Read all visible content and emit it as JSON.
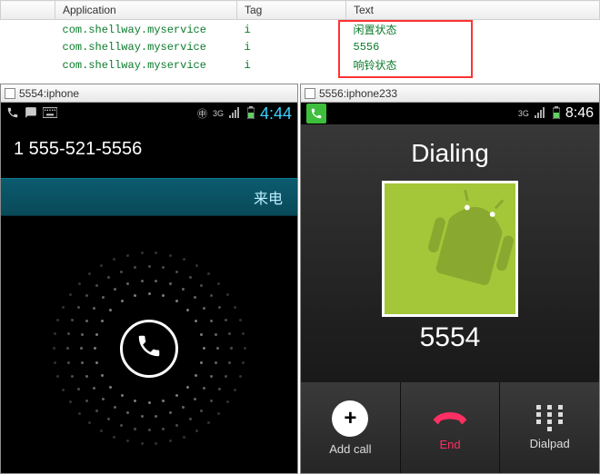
{
  "log": {
    "headers": {
      "blank": "",
      "application": "Application",
      "tag": "Tag",
      "text": "Text"
    },
    "rows": [
      {
        "app": "com.shellway.myservice",
        "tag": "i",
        "text": "闲置状态"
      },
      {
        "app": "com.shellway.myservice",
        "tag": "i",
        "text": "5556"
      },
      {
        "app": "com.shellway.myservice",
        "tag": "i",
        "text": "响铃状态"
      }
    ]
  },
  "emu1": {
    "title": "5554:iphone",
    "status": {
      "time": "4:44",
      "net": "3G"
    },
    "caller": "1 555-521-5556",
    "incoming_label": "来电"
  },
  "emu2": {
    "title": "5556:iphone233",
    "status": {
      "time": "8:46",
      "net": "3G"
    },
    "dialing_label": "Dialing",
    "dialed": "5554",
    "actions": {
      "add": "Add call",
      "end": "End",
      "dialpad": "Dialpad"
    }
  }
}
